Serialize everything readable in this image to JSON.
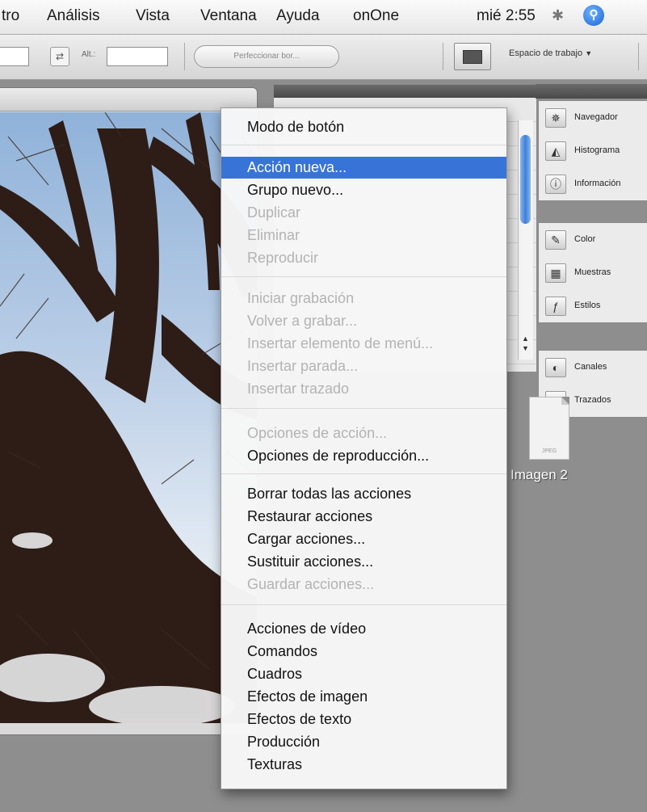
{
  "menubar": {
    "items": [
      "tro",
      "Análisis",
      "Vista",
      "Ventana",
      "Ayuda",
      "onOne"
    ],
    "clock": "mié 2:55",
    "bluetooth_icon": "bluetooth-icon",
    "spotlight_icon": "spotlight-icon"
  },
  "options_bar": {
    "alt_label": "Alt.:",
    "swap_icon": "swap-icon",
    "refine_button": "Perfeccionar bor...",
    "workspace_label": "Espacio de trabajo",
    "workspace_caret": "▼"
  },
  "document": {
    "image_description_icon": "tree-photo"
  },
  "dock": {
    "group1": [
      {
        "icon": "navigator-icon",
        "glyph": "✵",
        "label": "Navegador"
      },
      {
        "icon": "histogram-icon",
        "glyph": "◭",
        "label": "Histograma"
      },
      {
        "icon": "info-icon",
        "glyph": "ⓘ",
        "label": "Información"
      }
    ],
    "group2": [
      {
        "icon": "color-icon",
        "glyph": "✎",
        "label": "Color"
      },
      {
        "icon": "swatches-icon",
        "glyph": "▦",
        "label": "Muestras"
      },
      {
        "icon": "styles-icon",
        "glyph": "ƒ",
        "label": "Estilos"
      }
    ],
    "group3": [
      {
        "icon": "channels-icon",
        "glyph": "◐",
        "label": "Canales"
      },
      {
        "icon": "paths-icon",
        "glyph": "⌗",
        "label": "Trazados"
      }
    ]
  },
  "desktop": {
    "thumb_ext": "JPEG",
    "thumb_label": "Imagen 2"
  },
  "menu": {
    "items": [
      {
        "label": "Modo de botón",
        "state": "enabled"
      },
      {
        "label": "Acción nueva...",
        "state": "selected"
      },
      {
        "label": "Grupo nuevo...",
        "state": "enabled"
      },
      {
        "label": "Duplicar",
        "state": "disabled"
      },
      {
        "label": "Eliminar",
        "state": "disabled"
      },
      {
        "label": "Reproducir",
        "state": "disabled"
      },
      {
        "label": "Iniciar grabación",
        "state": "disabled"
      },
      {
        "label": "Volver a grabar...",
        "state": "disabled"
      },
      {
        "label": "Insertar elemento de menú...",
        "state": "disabled"
      },
      {
        "label": "Insertar parada...",
        "state": "disabled"
      },
      {
        "label": "Insertar trazado",
        "state": "disabled"
      },
      {
        "label": "Opciones de acción...",
        "state": "disabled"
      },
      {
        "label": "Opciones de reproducción...",
        "state": "enabled"
      },
      {
        "label": "Borrar todas las acciones",
        "state": "enabled"
      },
      {
        "label": "Restaurar acciones",
        "state": "enabled"
      },
      {
        "label": "Cargar acciones...",
        "state": "enabled"
      },
      {
        "label": "Sustituir acciones...",
        "state": "enabled"
      },
      {
        "label": "Guardar acciones...",
        "state": "disabled"
      },
      {
        "label": "Acciones de vídeo",
        "state": "enabled"
      },
      {
        "label": "Comandos",
        "state": "enabled"
      },
      {
        "label": "Cuadros",
        "state": "enabled"
      },
      {
        "label": "Efectos de imagen",
        "state": "enabled"
      },
      {
        "label": "Efectos de texto",
        "state": "enabled"
      },
      {
        "label": "Producción",
        "state": "enabled"
      },
      {
        "label": "Texturas",
        "state": "enabled"
      }
    ],
    "highlight_color": "#3874d8"
  }
}
